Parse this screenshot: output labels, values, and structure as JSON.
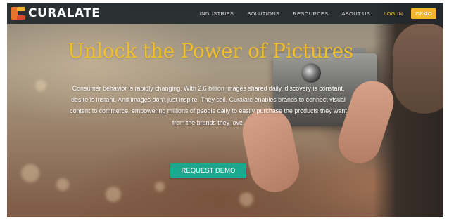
{
  "brand": {
    "name": "CURALATE",
    "logo_icon": "curalate-logo-icon",
    "logo_colors": [
      "#f2b52b",
      "#e8732c",
      "#d84a2a"
    ]
  },
  "nav": {
    "links": [
      "INDUSTRIES",
      "SOLUTIONS",
      "RESOURCES",
      "ABOUT US"
    ],
    "login_label": "LOG IN",
    "demo_label": "DEMO"
  },
  "hero": {
    "headline": "Unlock the Power of Pictures",
    "body": "Consumer behavior is rapidly changing. With 2.6 billion images shared daily, discovery is constant, desire is instant. And images don't just inspire. They sell. Curalate enables brands to connect visual content to commerce, empowering millions of people daily to easily purchase the products they want from the brands they love.",
    "cta_label": "REQUEST DEMO"
  },
  "colors": {
    "accent_yellow": "#f2b52b",
    "cta_green": "#18a98f",
    "nav_bg": "#22282c"
  }
}
